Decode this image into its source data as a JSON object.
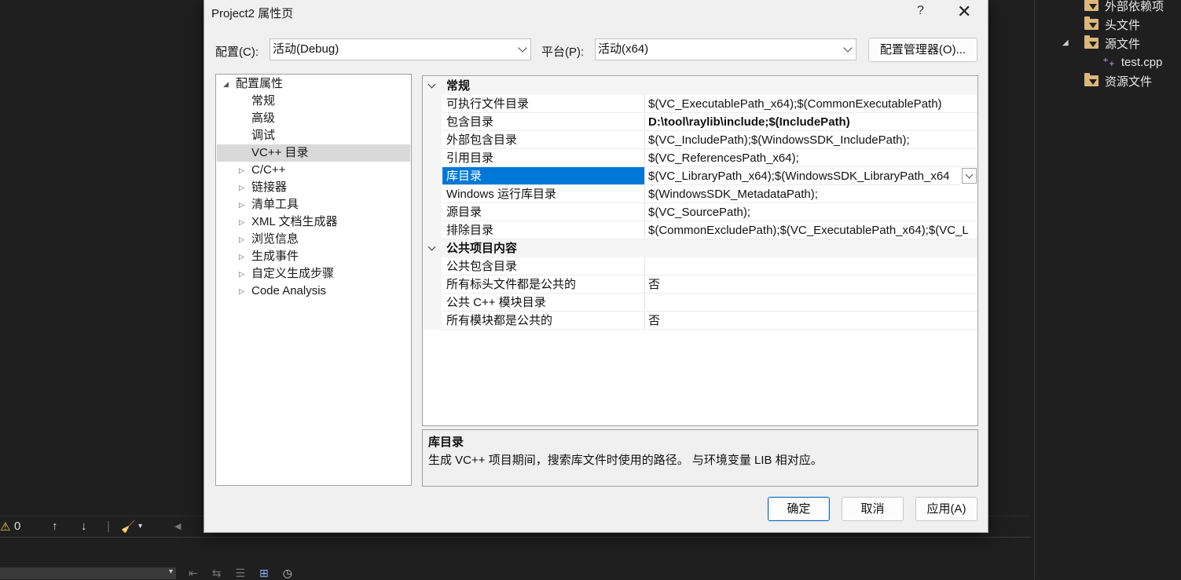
{
  "solution_explorer": {
    "items": [
      {
        "label": "外部依赖项",
        "icon": "external-deps-icon"
      },
      {
        "label": "头文件",
        "icon": "folder-icon"
      },
      {
        "label": "源文件",
        "icon": "folder-icon",
        "expanded": true
      },
      {
        "label": "test.cpp",
        "icon": "cpp-file-icon"
      },
      {
        "label": "资源文件",
        "icon": "folder-icon"
      }
    ]
  },
  "ide_bottom_bar": {
    "warning_count": "0"
  },
  "dialog": {
    "title": "Project2 属性页",
    "help_label": "?",
    "close_label": "✕",
    "config_label": "配置(C):",
    "config_value": "活动(Debug)",
    "platform_label": "平台(P):",
    "platform_value": "活动(x64)",
    "config_manager_label": "配置管理器(O)...",
    "tree": {
      "root": "配置属性",
      "items": [
        {
          "label": "常规",
          "expandable": false
        },
        {
          "label": "高级",
          "expandable": false
        },
        {
          "label": "调试",
          "expandable": false
        },
        {
          "label": "VC++ 目录",
          "expandable": false,
          "selected": true
        },
        {
          "label": "C/C++",
          "expandable": true
        },
        {
          "label": "链接器",
          "expandable": true
        },
        {
          "label": "清单工具",
          "expandable": true
        },
        {
          "label": "XML 文档生成器",
          "expandable": true
        },
        {
          "label": "浏览信息",
          "expandable": true
        },
        {
          "label": "生成事件",
          "expandable": true
        },
        {
          "label": "自定义生成步骤",
          "expandable": true
        },
        {
          "label": "Code Analysis",
          "expandable": true
        }
      ]
    },
    "grid": {
      "categories": [
        {
          "name": "常规",
          "rows": [
            {
              "name": "可执行文件目录",
              "value": "$(VC_ExecutablePath_x64);$(CommonExecutablePath)"
            },
            {
              "name": "包含目录",
              "value": "D:\\tool\\raylib\\include;$(IncludePath)",
              "bold": true
            },
            {
              "name": "外部包含目录",
              "value": "$(VC_IncludePath);$(WindowsSDK_IncludePath);"
            },
            {
              "name": "引用目录",
              "value": "$(VC_ReferencesPath_x64);"
            },
            {
              "name": "库目录",
              "value": "$(VC_LibraryPath_x64);$(WindowsSDK_LibraryPath_x64",
              "selected": true
            },
            {
              "name": "Windows 运行库目录",
              "value": "$(WindowsSDK_MetadataPath);"
            },
            {
              "name": "源目录",
              "value": "$(VC_SourcePath);"
            },
            {
              "name": "排除目录",
              "value": "$(CommonExcludePath);$(VC_ExecutablePath_x64);$(VC_L"
            }
          ]
        },
        {
          "name": "公共项目内容",
          "rows": [
            {
              "name": "公共包含目录",
              "value": ""
            },
            {
              "name": "所有标头文件都是公共的",
              "value": "否"
            },
            {
              "name": "公共 C++ 模块目录",
              "value": ""
            },
            {
              "name": "所有模块都是公共的",
              "value": "否"
            }
          ]
        }
      ]
    },
    "description": {
      "title": "库目录",
      "text": "生成 VC++ 项目期间，搜索库文件时使用的路径。 与环境变量 LIB 相对应。"
    },
    "buttons": {
      "ok": "确定",
      "cancel": "取消",
      "apply": "应用(A)"
    }
  },
  "colors": {
    "selection": "#0078d7",
    "dialog_bg": "#f0f0f0",
    "ide_bg": "#1f1f1f"
  }
}
